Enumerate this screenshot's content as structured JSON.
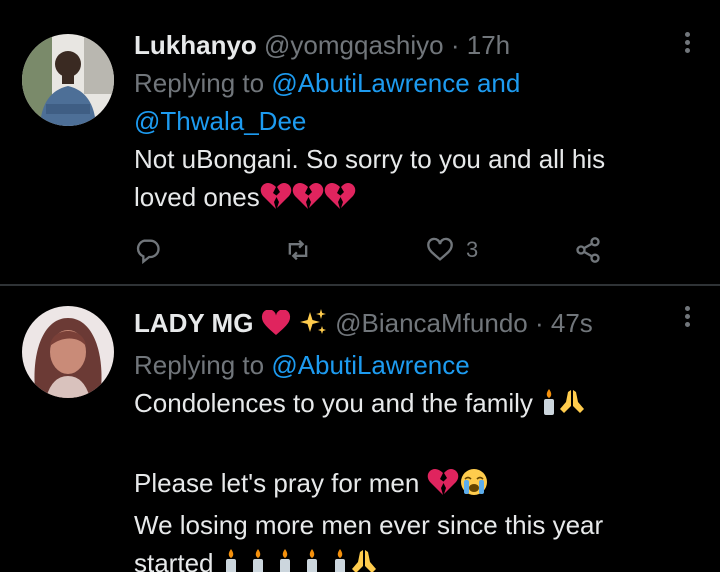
{
  "tweets": [
    {
      "name": "Lukhanyo",
      "handle": "@yomgqashiyo",
      "separator": "·",
      "time": "17h",
      "replying_prefix": "Replying to",
      "replying_mention_1": "@AbutiLawrence",
      "replying_and": "and",
      "replying_mention_2": "@Thwala_Dee",
      "text_line_1": "Not uBongani. So sorry to you and all his",
      "text_line_2": "loved ones",
      "emojis": [
        "broken-heart-icon",
        "broken-heart-icon",
        "broken-heart-icon"
      ],
      "like_count": "3"
    },
    {
      "name": "LADY MG",
      "handle": "@BiancaMfundo",
      "separator": "·",
      "time": "47s",
      "replying_prefix": "Replying to",
      "replying_mention_1": "@AbutiLawrence",
      "text_line_1": "Condolences to you and the family",
      "text_line_2": "Please let's pray for men",
      "text_line_3": "We losing more men ever since this year",
      "text_line_4": "started"
    }
  ],
  "colors": {
    "background": "#000000",
    "text": "#e7e9ea",
    "muted": "#71767b",
    "link": "#1d9bf0",
    "divider": "#2f3336",
    "heart_red": "#e0245e"
  }
}
